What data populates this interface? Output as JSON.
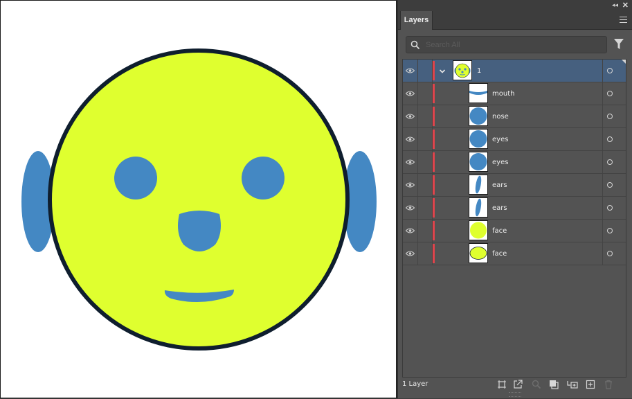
{
  "panel": {
    "tab_label": "Layers",
    "search_placeholder": "Search All",
    "layer_count_label": "1 Layer"
  },
  "colors": {
    "face_fill": "#dfff2f",
    "face_stroke": "#0f1e2e",
    "feature_blue": "#4488c3",
    "selection_highlight": "#46607f",
    "layer_color_bar": "#e0444c"
  },
  "layers": [
    {
      "name": "1",
      "kind": "layer",
      "expanded": true,
      "selected": true,
      "thumb": "face-preview"
    },
    {
      "name": "mouth",
      "kind": "sublayer",
      "thumb": "mouth"
    },
    {
      "name": "nose",
      "kind": "sublayer",
      "thumb": "circle"
    },
    {
      "name": "eyes",
      "kind": "sublayer",
      "thumb": "circle"
    },
    {
      "name": "eyes",
      "kind": "sublayer",
      "thumb": "circle"
    },
    {
      "name": "ears",
      "kind": "sublayer",
      "thumb": "ear"
    },
    {
      "name": "ears",
      "kind": "sublayer",
      "thumb": "ear"
    },
    {
      "name": "face",
      "kind": "sublayer",
      "thumb": "yellow-circle"
    },
    {
      "name": "face",
      "kind": "sublayer",
      "thumb": "yellow-ellipse"
    }
  ],
  "footer_buttons": [
    {
      "name": "collect-for-export-button",
      "glyph": "collect"
    },
    {
      "name": "export-button",
      "glyph": "export"
    },
    {
      "name": "locate-object-button",
      "glyph": "search"
    },
    {
      "name": "make-clipping-mask-button",
      "glyph": "mask"
    },
    {
      "name": "create-new-sublayer-button",
      "glyph": "sublayer"
    },
    {
      "name": "create-new-layer-button",
      "glyph": "newlayer"
    },
    {
      "name": "delete-layer-button",
      "glyph": "trash"
    }
  ]
}
